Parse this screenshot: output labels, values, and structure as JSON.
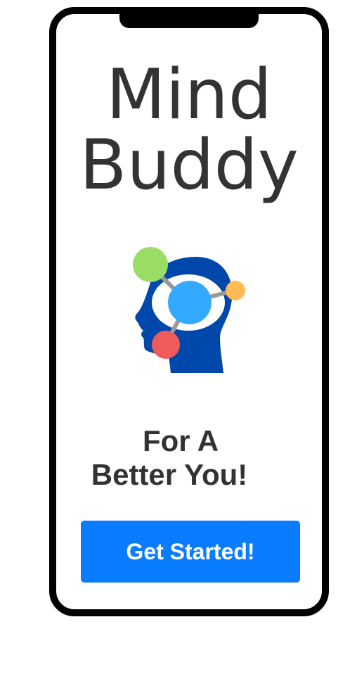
{
  "app": {
    "title_line_1": "Mind",
    "title_line_2": "Buddy"
  },
  "logo": {
    "icon": "brain-network-head-icon",
    "colors": {
      "head": "#0047ab",
      "center_node": "#33aaff",
      "top_node": "#99dd66",
      "right_node": "#ffbb55",
      "bottom_node": "#f05a5a",
      "connector": "#999999"
    }
  },
  "tagline": {
    "line_1": "For A",
    "line_2": "Better You!"
  },
  "cta": {
    "label": "Get Started!",
    "color": "#0a7cff"
  }
}
